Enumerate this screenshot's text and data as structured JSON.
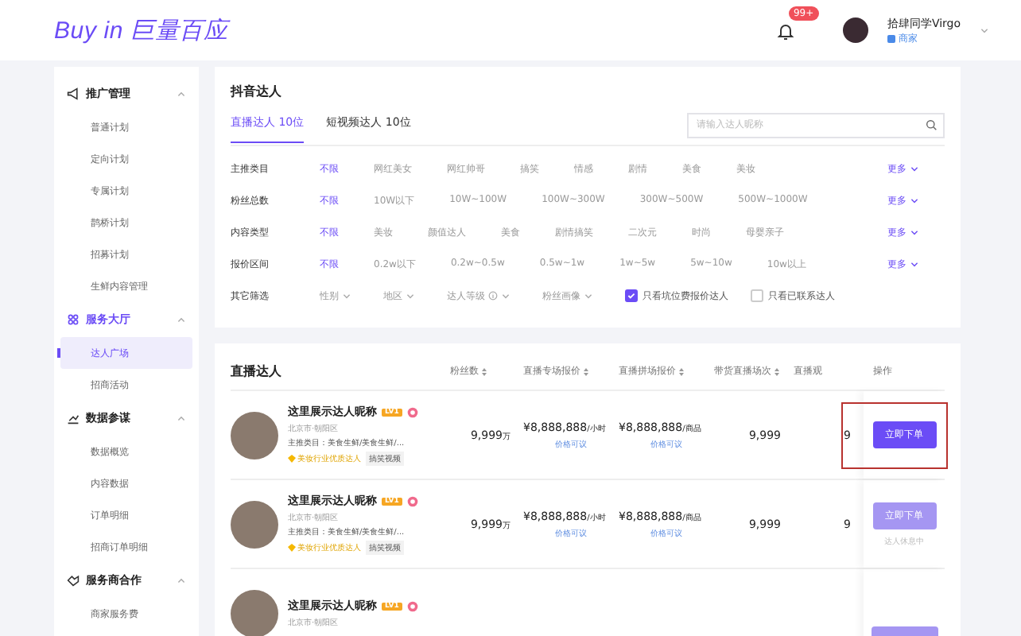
{
  "header": {
    "logo": "Buy in 巨量百应",
    "notification_badge": "99+",
    "user": {
      "name": "拾肆同学Virgo",
      "role": "商家"
    }
  },
  "sidebar": {
    "groups": [
      {
        "title": "推广管理",
        "expanded": true,
        "active": false,
        "items": [
          {
            "label": "普通计划",
            "selected": false
          },
          {
            "label": "定向计划",
            "selected": false
          },
          {
            "label": "专属计划",
            "selected": false
          },
          {
            "label": "鹊桥计划",
            "selected": false
          },
          {
            "label": "招募计划",
            "selected": false
          },
          {
            "label": "生鲜内容管理",
            "selected": false
          }
        ]
      },
      {
        "title": "服务大厅",
        "expanded": true,
        "active": true,
        "items": [
          {
            "label": "达人广场",
            "selected": true
          },
          {
            "label": "招商活动",
            "selected": false
          }
        ]
      },
      {
        "title": "数据参谋",
        "expanded": true,
        "active": false,
        "items": [
          {
            "label": "数据概览",
            "selected": false
          },
          {
            "label": "内容数据",
            "selected": false
          },
          {
            "label": "订单明细",
            "selected": false
          },
          {
            "label": "招商订单明细",
            "selected": false
          }
        ]
      },
      {
        "title": "服务商合作",
        "expanded": true,
        "active": false,
        "items": [
          {
            "label": "商家服务费",
            "selected": false
          }
        ]
      }
    ]
  },
  "filter_panel": {
    "title": "抖音达人",
    "tabs": [
      {
        "label": "直播达人 10位",
        "selected": true
      },
      {
        "label": "短视频达人 10位",
        "selected": false
      }
    ],
    "search": {
      "placeholder": "请输入达人昵称"
    },
    "filters": [
      {
        "label": "主推类目",
        "options": [
          {
            "label": "不限",
            "selected": true
          },
          {
            "label": "网红美女",
            "selected": false
          },
          {
            "label": "网红帅哥",
            "selected": false
          },
          {
            "label": "搞笑",
            "selected": false
          },
          {
            "label": "情感",
            "selected": false
          },
          {
            "label": "剧情",
            "selected": false
          },
          {
            "label": "美食",
            "selected": false
          },
          {
            "label": "美妆",
            "selected": false
          }
        ],
        "more": "更多"
      },
      {
        "label": "粉丝总数",
        "options": [
          {
            "label": "不限",
            "selected": true
          },
          {
            "label": "10W以下",
            "selected": false
          },
          {
            "label": "10W~100W",
            "selected": false
          },
          {
            "label": "100W~300W",
            "selected": false
          },
          {
            "label": "300W~500W",
            "selected": false
          },
          {
            "label": "500W~1000W",
            "selected": false
          }
        ],
        "more": "更多"
      },
      {
        "label": "内容类型",
        "options": [
          {
            "label": "不限",
            "selected": true
          },
          {
            "label": "美妆",
            "selected": false
          },
          {
            "label": "颜值达人",
            "selected": false
          },
          {
            "label": "美食",
            "selected": false
          },
          {
            "label": "剧情搞笑",
            "selected": false
          },
          {
            "label": "二次元",
            "selected": false
          },
          {
            "label": "时尚",
            "selected": false
          },
          {
            "label": "母婴亲子",
            "selected": false
          }
        ],
        "more": "更多"
      },
      {
        "label": "报价区间",
        "options": [
          {
            "label": "不限",
            "selected": true
          },
          {
            "label": "0.2w以下",
            "selected": false
          },
          {
            "label": "0.2w~0.5w",
            "selected": false
          },
          {
            "label": "0.5w~1w",
            "selected": false
          },
          {
            "label": "1w~5w",
            "selected": false
          },
          {
            "label": "5w~10w",
            "selected": false
          },
          {
            "label": "10w以上",
            "selected": false
          }
        ],
        "more": "更多"
      }
    ],
    "other": {
      "label": "其它筛选",
      "dropdowns": [
        {
          "label": "性别",
          "info": false
        },
        {
          "label": "地区",
          "info": false
        },
        {
          "label": "达人等级",
          "info": true
        },
        {
          "label": "粉丝画像",
          "info": false
        }
      ],
      "checkboxes": [
        {
          "label": "只看坑位费报价达人",
          "checked": true
        },
        {
          "label": "只看已联系达人",
          "checked": false
        }
      ]
    }
  },
  "table": {
    "title": "直播达人",
    "columns": [
      "粉丝数",
      "直播专场报价",
      "直播拼场报价",
      "带货直播场次",
      "直播观",
      "操作"
    ],
    "rows": [
      {
        "name": "这里展示达人昵称",
        "level": "LV1",
        "location": "北京市·朝阳区",
        "category": "主推类目：美食生鲜/美食生鲜/...",
        "honor": "美妆行业优质达人",
        "tag": "搞笑视频",
        "fans": "9,999",
        "fans_unit": "万",
        "price_special": "¥8,888,888",
        "price_special_unit": "/小时",
        "price_special_note": "价格可议",
        "price_shared": "¥8,888,888",
        "price_shared_unit": "/商品",
        "price_shared_note": "价格可议",
        "sessions": "9,999",
        "views": "9",
        "action": "立即下单",
        "disabled": false,
        "highlighted": true
      },
      {
        "name": "这里展示达人昵称",
        "level": "LV1",
        "location": "北京市·朝阳区",
        "category": "主推类目：美食生鲜/美食生鲜/...",
        "honor": "美妆行业优质达人",
        "tag": "搞笑视频",
        "fans": "9,999",
        "fans_unit": "万",
        "price_special": "¥8,888,888",
        "price_special_unit": "/小时",
        "price_special_note": "价格可议",
        "price_shared": "¥8,888,888",
        "price_shared_unit": "/商品",
        "price_shared_note": "价格可议",
        "sessions": "9,999",
        "views": "9",
        "action": "立即下单",
        "disabled": true,
        "status": "达人休息中",
        "highlighted": false
      },
      {
        "name": "这里展示达人昵称",
        "level": "LV1",
        "location": "北京市·朝阳区",
        "disabled": true,
        "highlighted": false
      }
    ]
  }
}
